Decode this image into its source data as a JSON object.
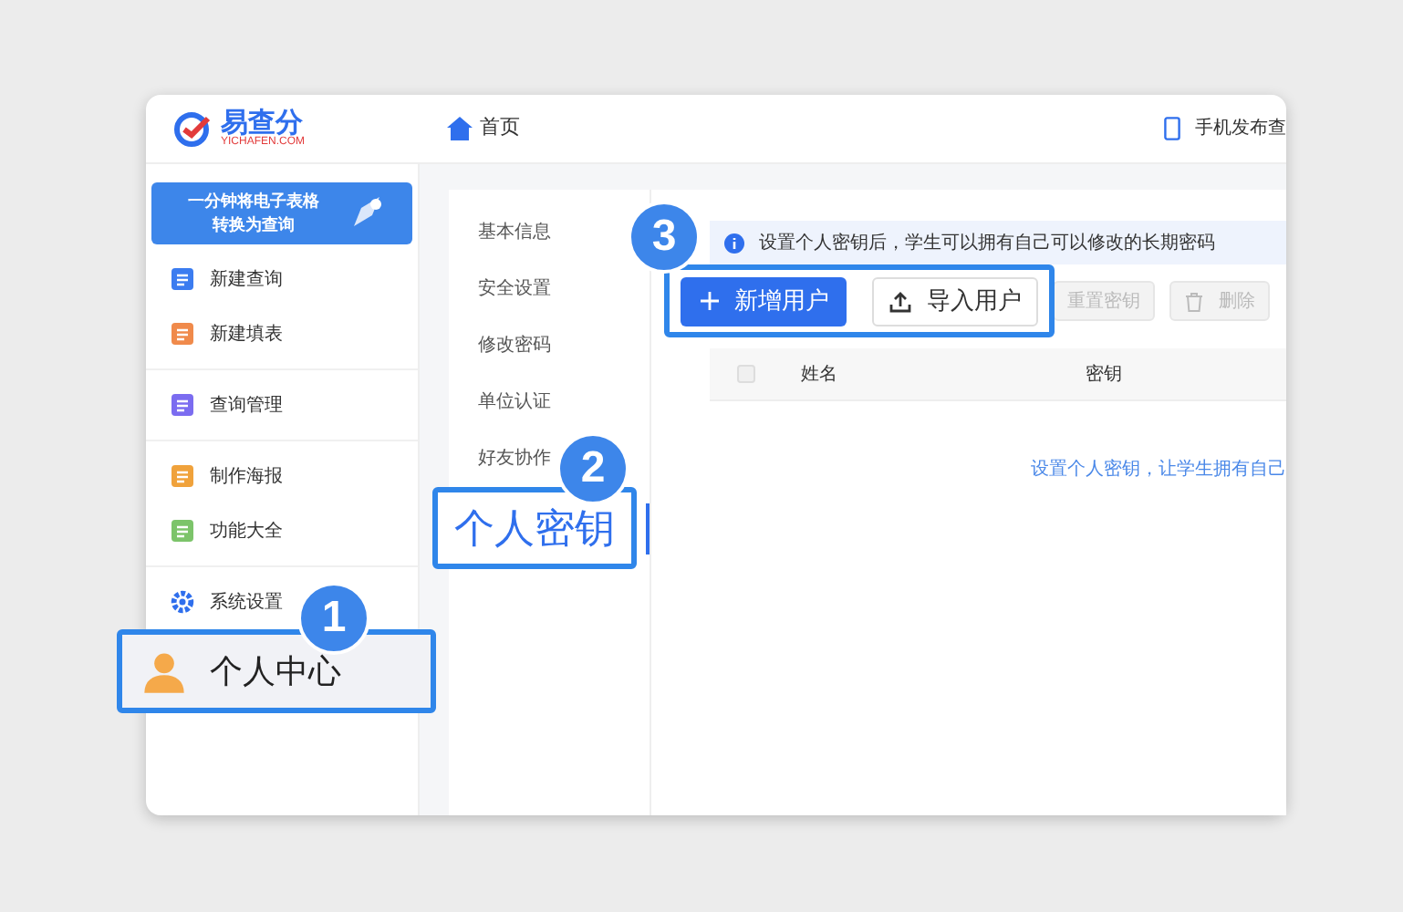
{
  "header": {
    "logo": {
      "name": "易查分",
      "domain": "YICHAFEN.COM"
    },
    "nav": "首页",
    "mobile_link": "手机发布查"
  },
  "sidebar": {
    "banner": [
      "一分钟将电子表格",
      "转换为查询"
    ],
    "groups": [
      [
        {
          "label": "新建查询",
          "kind": "query",
          "selected": false
        },
        {
          "label": "新建填表",
          "kind": "form",
          "selected": false
        }
      ],
      [
        {
          "label": "查询管理",
          "kind": "manage",
          "selected": false
        }
      ],
      [
        {
          "label": "制作海报",
          "kind": "poster",
          "selected": false
        },
        {
          "label": "功能大全",
          "kind": "features",
          "selected": false
        }
      ],
      [
        {
          "label": "系统设置",
          "kind": "settings",
          "selected": false
        },
        {
          "label": "个人中心",
          "kind": "profile",
          "selected": true,
          "callout": "1"
        }
      ]
    ]
  },
  "submenu": [
    {
      "label": "基本信息",
      "selected": false
    },
    {
      "label": "安全设置",
      "selected": false
    },
    {
      "label": "修改密码",
      "selected": false
    },
    {
      "label": "单位认证",
      "selected": false
    },
    {
      "label": "好友协作",
      "selected": false
    },
    {
      "label": "个人密钥",
      "selected": true,
      "callout": "2"
    }
  ],
  "notice": "设置个人密钥后，学生可以拥有自己可以修改的长期密码",
  "toolbar": {
    "callout": "3",
    "buttons": [
      {
        "label": "新增用户",
        "kind": "add",
        "primary": true,
        "disabled": false
      },
      {
        "label": "导入用户",
        "kind": "upload",
        "primary": false,
        "disabled": false
      },
      {
        "label": "重置密钥",
        "kind": "reset",
        "primary": false,
        "disabled": true
      },
      {
        "label": "删除",
        "kind": "delete",
        "primary": false,
        "disabled": true
      }
    ]
  },
  "table": {
    "select_all_checked": false,
    "columns": [
      "姓名",
      "密钥"
    ],
    "empty_text": "设置个人密钥，让学生拥有自己"
  }
}
